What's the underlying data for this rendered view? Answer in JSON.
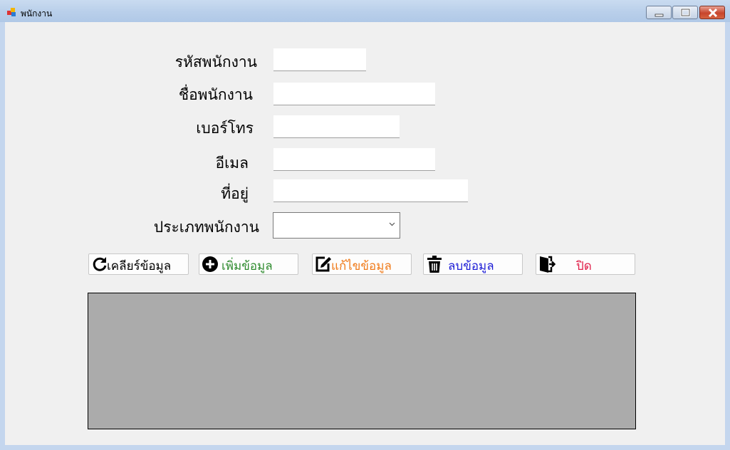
{
  "window": {
    "title": "พนักงาน",
    "controls": {
      "minimize": "minimize",
      "maximize": "maximize",
      "close": "close"
    }
  },
  "form": {
    "fields": [
      {
        "id": "employee_id",
        "label": "รหัสพนักงาน",
        "value": ""
      },
      {
        "id": "employee_name",
        "label": "ชื่อพนักงาน",
        "value": ""
      },
      {
        "id": "phone",
        "label": "เบอร์โทร",
        "value": ""
      },
      {
        "id": "email",
        "label": "อีเมล",
        "value": ""
      },
      {
        "id": "address",
        "label": "ที่อยู่",
        "value": ""
      },
      {
        "id": "employee_type",
        "label": "ประเภทพนักงาน",
        "value": ""
      }
    ]
  },
  "buttons": {
    "clear": {
      "label": "เคลียร์ข้อมูล",
      "color": "#000000",
      "icon": "refresh-icon"
    },
    "add": {
      "label": "เพิ่มข้อมูล",
      "color": "#2e8b2e",
      "icon": "plus-circle-icon"
    },
    "edit": {
      "label": "แก้ไขข้อมูล",
      "color": "#f07b1a",
      "icon": "edit-icon"
    },
    "delete": {
      "label": "ลบข้อมูล",
      "color": "#1d1dd6",
      "icon": "trash-icon"
    },
    "close": {
      "label": "ปิด",
      "color": "#e0204a",
      "icon": "exit-door-icon"
    }
  },
  "colors": {
    "titlebar": "#b9cfea",
    "client": "#f0f0f0",
    "grid": "#ababab"
  }
}
